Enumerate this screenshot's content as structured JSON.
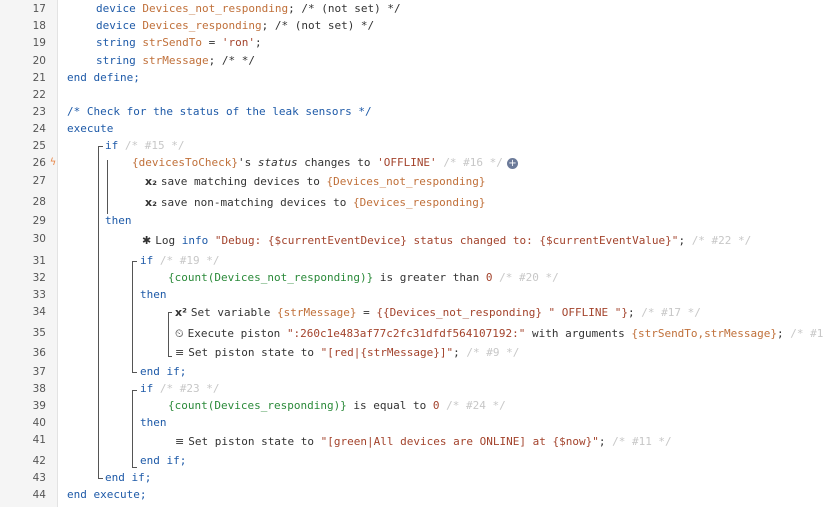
{
  "gutter": {
    "lines": [
      "17",
      "18",
      "19",
      "20",
      "21",
      "22",
      "23",
      "24",
      "25",
      "26",
      "27",
      "28",
      "29",
      "30",
      "31",
      "32",
      "33",
      "34",
      "35",
      "36",
      "37",
      "38",
      "39",
      "40",
      "41",
      "42",
      "43",
      "44"
    ],
    "bolt_icon": "lightning-bolt-icon"
  },
  "code": {
    "l17": {
      "kw": "device",
      "var": "Devices_not_responding",
      "rest": ";",
      "cm": "/* (not set) */"
    },
    "l18": {
      "kw": "device",
      "var": "Devices_responding",
      "rest": ";",
      "cm": "/* (not set) */"
    },
    "l19": {
      "kw": "string",
      "var": "strSendTo",
      "eq": " = ",
      "str": "'ron'",
      "rest": ";"
    },
    "l20": {
      "kw": "string",
      "var": "strMessage",
      "rest": ";",
      "cm": "/* */"
    },
    "l21": {
      "text": "end define;"
    },
    "l23": {
      "text": "/* Check for the status of the leak sensors */"
    },
    "l24": {
      "text": "execute"
    },
    "l25": {
      "kw": "if",
      "cm": "/* #15 */"
    },
    "l26": {
      "var": "{devicesToCheck}",
      "mid": "'s ",
      "ital": "status",
      "mid2": " changes to ",
      "str": "'OFFLINE'",
      "cm": "/* #16 */",
      "plus": "+"
    },
    "l27": {
      "icon": "x₂",
      "text": "save matching devices to ",
      "var": "{Devices_not_responding}"
    },
    "l28": {
      "icon": "x₂",
      "text": "save non-matching devices to ",
      "var": "{Devices_responding}"
    },
    "l29": {
      "kw": "then"
    },
    "l30": {
      "log": "Log ",
      "info": "info",
      "str": "\"Debug: {$currentEventDevice} status changed to: {$currentEventValue}\"",
      "rest": ";",
      "cm": "/* #22 */"
    },
    "l31": {
      "kw": "if",
      "cm": "/* #19 */"
    },
    "l32": {
      "ev": "{count(Devices_not_responding)}",
      "mid": " is greater than ",
      "num": "0",
      "cm": "/* #20 */"
    },
    "l33": {
      "kw": "then"
    },
    "l34": {
      "icon": "x²",
      "text": "Set variable ",
      "var": "{strMessage}",
      "eq": " = ",
      "str": "{{Devices_not_responding} \" OFFLINE \"}",
      "rest": ";",
      "cm": "/* #17 */"
    },
    "l35": {
      "text": "Execute piston ",
      "str": "\":260c1e483af77c2fc31dfdf564107192:\"",
      "mid": " with arguments ",
      "var": "{strSendTo,strMessage}",
      "rest": ";",
      "cm": "/* #1"
    },
    "l36": {
      "text": "Set piston state to ",
      "str": "\"[red|{strMessage}]\"",
      "rest": ";",
      "cm": "/* #9 */"
    },
    "l37": {
      "kw": "end if;"
    },
    "l38": {
      "kw": "if",
      "cm": "/* #23 */"
    },
    "l39": {
      "ev": "{count(Devices_responding)}",
      "mid": " is equal to ",
      "num": "0",
      "cm": "/* #24 */"
    },
    "l40": {
      "kw": "then"
    },
    "l41": {
      "text": "Set piston state to ",
      "str": "\"[green|All devices are ONLINE] at {$now}\"",
      "rest": ";",
      "cm": "/* #11 */"
    },
    "l42": {
      "kw": "end if;"
    },
    "l43": {
      "kw": "end if;"
    },
    "l44": {
      "text": "end execute;"
    }
  },
  "colors": {
    "keyword": "#1e5aa8",
    "variable": "#c0703a",
    "string": "#a3432c",
    "comment": "#c7c7c7",
    "event": "#2b8a3a"
  }
}
